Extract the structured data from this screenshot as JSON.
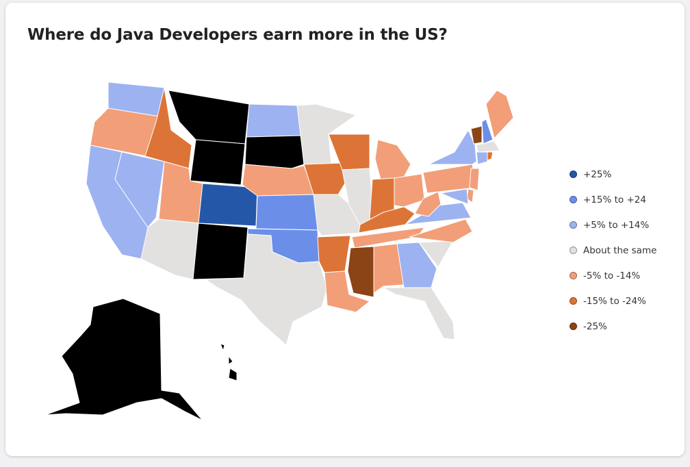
{
  "title": "Where do Java Developers earn more in the US?",
  "legend": [
    {
      "key": "p25",
      "label": "+25%",
      "color": "#2457a8"
    },
    {
      "key": "p15",
      "label": "+15% to +24",
      "color": "#6b8fe9"
    },
    {
      "key": "p5",
      "label": "+5% to +14%",
      "color": "#9db2f0"
    },
    {
      "key": "same",
      "label": "About the same",
      "color": "#e2e1df"
    },
    {
      "key": "m5",
      "label": "-5% to -14%",
      "color": "#f29e78"
    },
    {
      "key": "m15",
      "label": "-15% to -24%",
      "color": "#dd7437"
    },
    {
      "key": "m25",
      "label": "-25%",
      "color": "#8b4416"
    }
  ],
  "no_data_color": "#000000",
  "state_categories": {
    "Washington": "p5",
    "Oregon": "m5",
    "California": "p5",
    "Nevada": "p5",
    "Idaho": "m15",
    "Montana": "none",
    "Wyoming": "none",
    "Utah": "m5",
    "Arizona": "same",
    "Colorado": "p25",
    "New Mexico": "none",
    "North Dakota": "p5",
    "South Dakota": "none",
    "Nebraska": "m5",
    "Kansas": "p15",
    "Oklahoma": "p15",
    "Texas": "same",
    "Minnesota": "same",
    "Iowa": "m15",
    "Missouri": "same",
    "Arkansas": "m15",
    "Louisiana": "m5",
    "Wisconsin": "m15",
    "Illinois": "same",
    "Michigan": "m5",
    "Indiana": "m15",
    "Ohio": "m5",
    "Kentucky": "m15",
    "Tennessee": "m5",
    "Mississippi": "m25",
    "Alabama": "m5",
    "Georgia": "p5",
    "Florida": "same",
    "South Carolina": "same",
    "North Carolina": "m5",
    "Virginia": "p5",
    "West Virginia": "m5",
    "Pennsylvania": "m5",
    "New York": "p5",
    "Vermont": "m25",
    "New Hampshire": "p15",
    "Maine": "m5",
    "Massachusetts": "same",
    "Connecticut": "p5",
    "Rhode Island": "m15",
    "New Jersey": "m5",
    "Delaware": "m5",
    "Maryland": "p5",
    "Alaska": "none",
    "Hawaii": "none"
  }
}
